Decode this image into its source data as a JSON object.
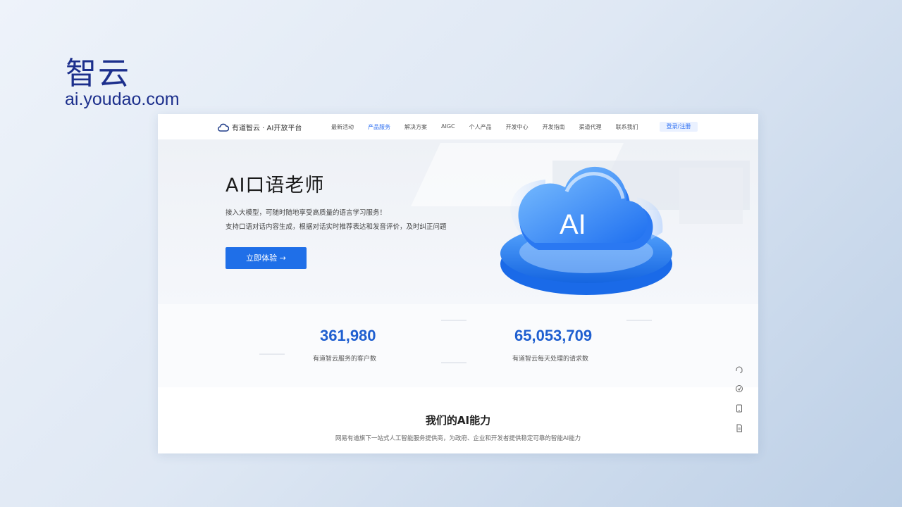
{
  "overlay": {
    "title": "智云",
    "url": "ai.youdao.com"
  },
  "nav": {
    "logo_text": "有道智云 · AI开放平台",
    "items": [
      "最新活动",
      "产品服务",
      "解决方案",
      "AIGC",
      "个人产品",
      "开发中心",
      "开发指南",
      "渠道代理",
      "联系我们"
    ],
    "login": "登录/注册"
  },
  "hero": {
    "title": "AI口语老师",
    "desc_line1": "接入大模型，可随时随地享受高质量的语言学习服务！",
    "desc_line2": "支持口语对话内容生成，根据对话实时推荐表达和发音评价，及时纠正问题",
    "cta": "立即体验 →",
    "illustration_text": "AI"
  },
  "stats": [
    {
      "number": "361,980",
      "label": "有道智云服务的客户数"
    },
    {
      "number": "65,053,709",
      "label": "有道智云每天处理的请求数"
    }
  ],
  "ability": {
    "title": "我们的AI能力",
    "subtitle": "网易有道旗下一站式人工智能服务提供商，为政府、企业和开发者提供稳定可靠的智能AI能力"
  },
  "colors": {
    "brand": "#1c2f8c",
    "accent": "#1f6fe8",
    "stat": "#1f5fd0"
  }
}
